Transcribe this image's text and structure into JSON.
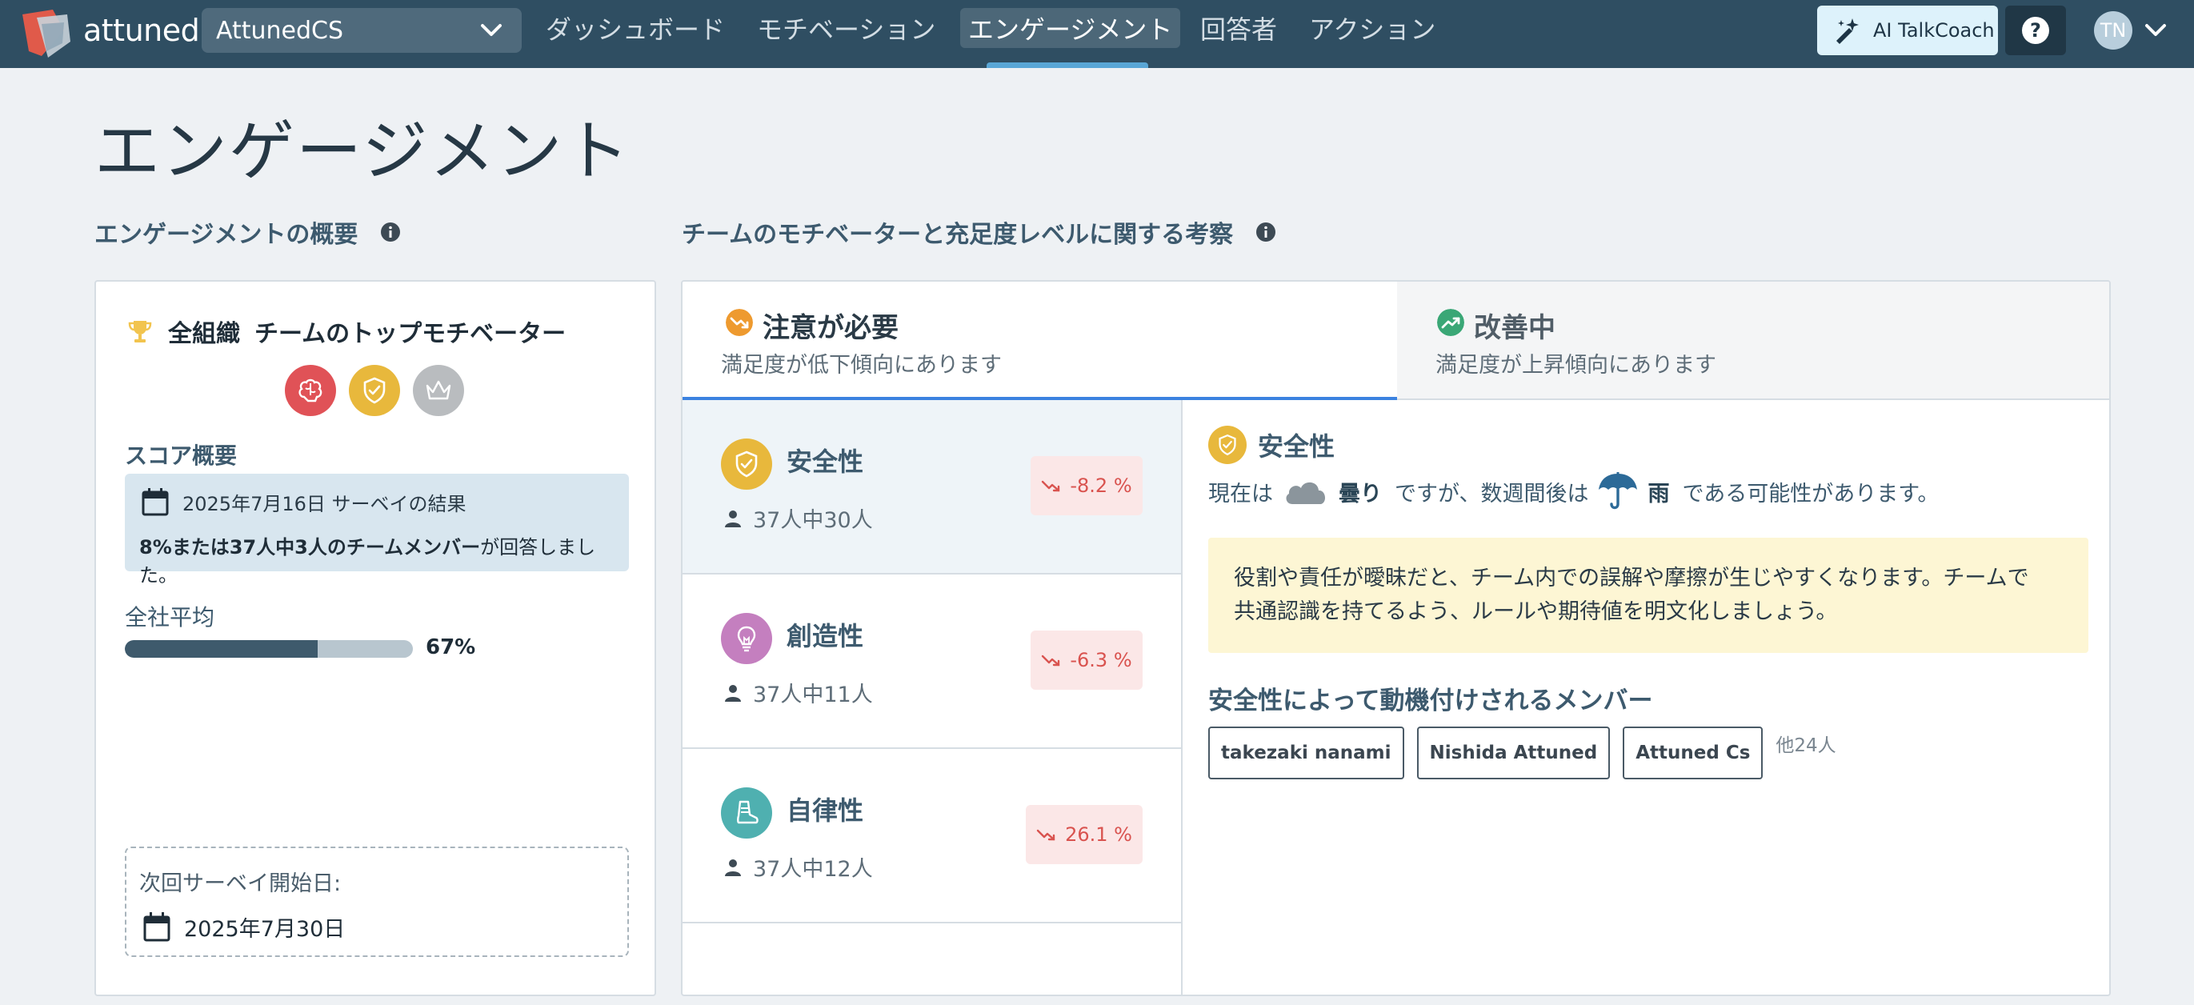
{
  "navbar": {
    "brand": "attuned",
    "org_select": "AttunedCS",
    "nav_items": [
      "ダッシュボード",
      "モチベーション",
      "エンゲージメント",
      "回答者",
      "アクション"
    ],
    "active_nav": "エンゲージメント",
    "talkcoach_label": "AI TalkCoach",
    "avatar_initials": "TN"
  },
  "page": {
    "title": "エンゲージメント"
  },
  "overview": {
    "section_title": "エンゲージメントの概要",
    "scope": "全組織",
    "heading": "チームのトップモチベーター",
    "top_motivators": [
      "brain-icon",
      "shield-icon",
      "crown-icon"
    ],
    "score_title": "スコア概要",
    "survey_result": "2025年7月16日 サーベイの結果",
    "response_bold": "8%または37人中3人のチームメンバー",
    "response_rest": "が回答しました。",
    "company_avg_label": "全社平均",
    "company_avg_percent": 67,
    "company_avg_text": "67%",
    "next_survey_label": "次回サーベイ開始日:",
    "next_survey_date": "2025年7月30日"
  },
  "insights": {
    "section_title": "チームのモチベーターと充足度レベルに関する考察",
    "tabs": [
      {
        "title": "注意が必要",
        "subtitle": "満足度が低下傾向にあります",
        "active": true
      },
      {
        "title": "改善中",
        "subtitle": "満足度が上昇傾向にあります",
        "active": false
      }
    ],
    "items": [
      {
        "name": "安全性",
        "count": "37人中30人",
        "change": "-8.2 %"
      },
      {
        "name": "創造性",
        "count": "37人中11人",
        "change": "-6.3 %"
      },
      {
        "name": "自律性",
        "count": "37人中12人",
        "change": "26.1 %"
      }
    ],
    "detail": {
      "name": "安全性",
      "forecast_prefix": "現在は",
      "current_weather": "曇り",
      "forecast_mid": "ですが、数週間後は",
      "future_weather": "雨",
      "forecast_suffix": "である可能性があります。",
      "advice_line1": "役割や責任が曖昧だと、チーム内での誤解や摩擦が生じやすくなります。チームで",
      "advice_line2": "共通認識を持てるよう、ルールや期待値を明文化しましょう。",
      "members_title": "安全性によって動機付けされるメンバー",
      "members": [
        "takezaki nanami",
        "Nishida Attuned",
        "Attuned Cs"
      ],
      "others": "他24人"
    }
  },
  "colors": {
    "navbar": "#2f4e62",
    "accent_blue": "#3b82e0",
    "safety_yellow": "#e8b83c",
    "creativity_purple": "#c47fbf",
    "autonomy_teal": "#4fb0b0",
    "decline_red": "#d9534f",
    "improve_green": "#3aa776"
  }
}
